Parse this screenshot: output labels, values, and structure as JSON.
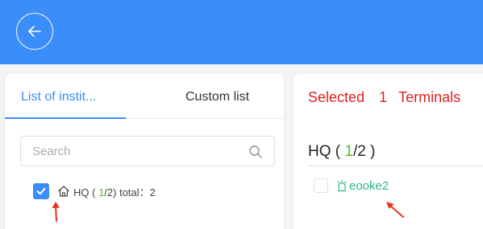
{
  "header": {
    "back_icon": "back-arrow-icon",
    "background_color": "#3b8dfa"
  },
  "left_panel": {
    "tabs": [
      {
        "label": "List of instit...",
        "active": true
      },
      {
        "label": "Custom list",
        "active": false
      }
    ],
    "search": {
      "placeholder": "Search",
      "value": "",
      "icon": "search-icon"
    },
    "tree": [
      {
        "checked": true,
        "icon": "home-icon",
        "name": "HQ",
        "paren_open": " ( ",
        "selected": "1",
        "total_of": "/2) total：",
        "total": "2"
      }
    ]
  },
  "right_panel": {
    "selected_label": "Selected",
    "selected_count": "1",
    "terminals_label": "Terminals",
    "group": {
      "name": "HQ",
      "open": " ( ",
      "selected": "1",
      "rest": "/2 )"
    },
    "devices": [
      {
        "name": "eooke2",
        "checked": false,
        "icon": "alarm-bell-icon"
      }
    ]
  },
  "colors": {
    "accent": "#3b8dfa",
    "selected_red": "#e02020",
    "count_green": "#52c41a",
    "device_teal": "#2bb58a",
    "annotation_arrow": "#e8341c"
  }
}
